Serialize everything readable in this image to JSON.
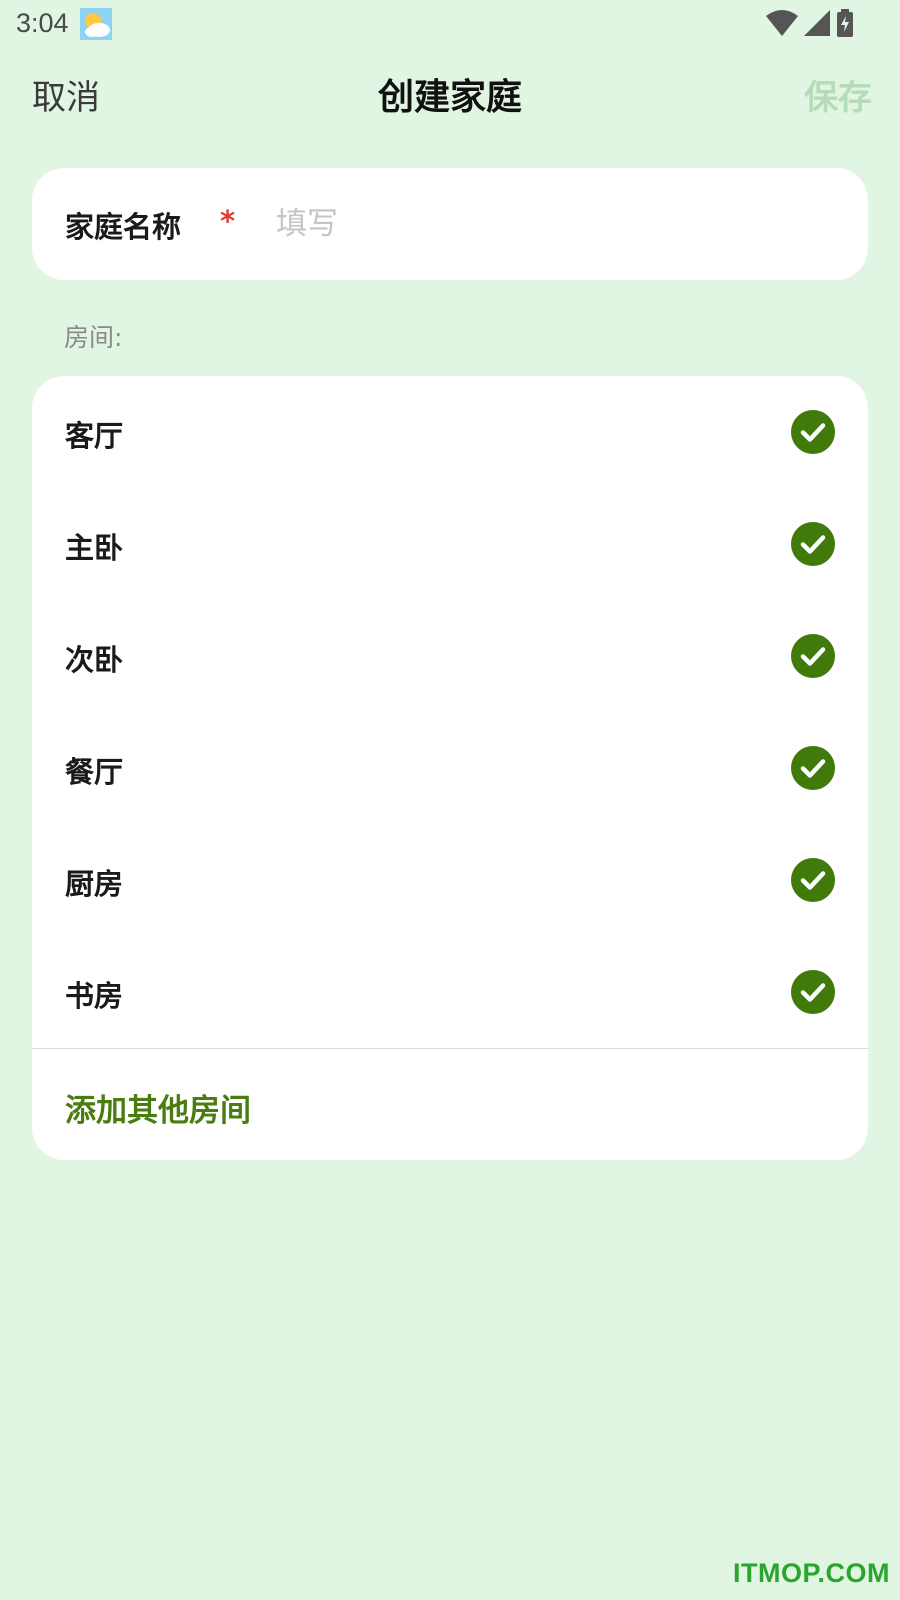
{
  "status_bar": {
    "time": "3:04",
    "icons": [
      "weather-icon",
      "wifi-icon",
      "cell-signal-icon",
      "battery-charging-icon"
    ]
  },
  "header": {
    "cancel_label": "取消",
    "title": "创建家庭",
    "save_label": "保存"
  },
  "family_name": {
    "label": "家庭名称",
    "required_mark": "*",
    "placeholder": "填写",
    "value": ""
  },
  "rooms": {
    "label": "房间:",
    "items": [
      {
        "name": "客厅",
        "checked": true
      },
      {
        "name": "主卧",
        "checked": true
      },
      {
        "name": "次卧",
        "checked": true
      },
      {
        "name": "餐厅",
        "checked": true
      },
      {
        "name": "厨房",
        "checked": true
      },
      {
        "name": "书房",
        "checked": true
      }
    ],
    "add_label": "添加其他房间"
  },
  "watermark": "ITMOP.COM",
  "colors": {
    "background": "#e1f5e3",
    "accent": "#4a7d0f",
    "check": "#3f7a0a",
    "required": "#e53935",
    "save_disabled": "#b5dcb8"
  }
}
